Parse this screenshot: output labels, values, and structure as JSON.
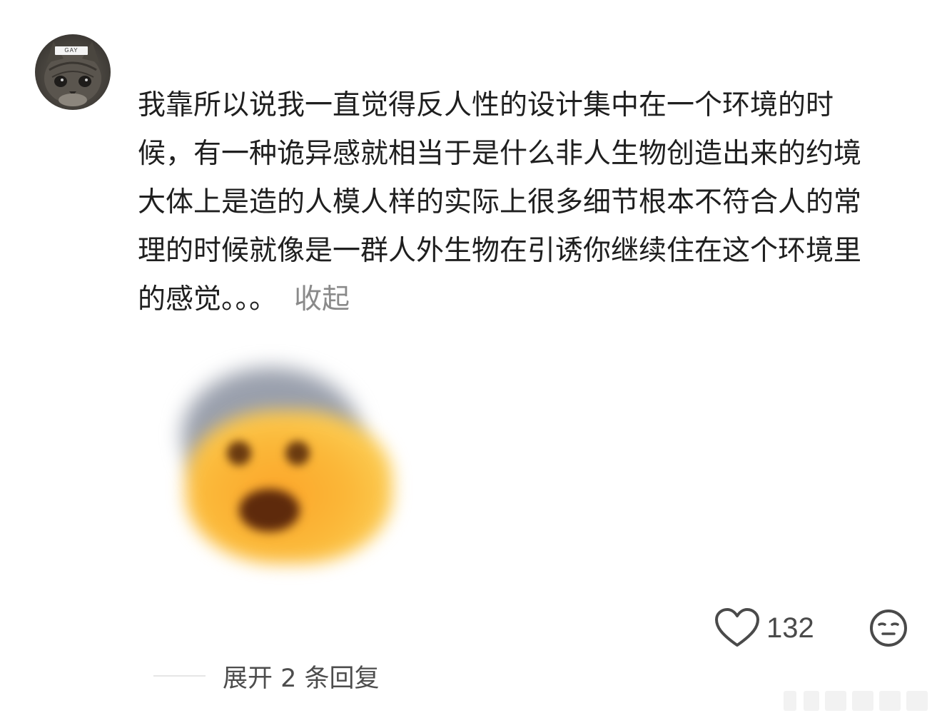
{
  "avatar": {
    "tag_text": "GAY",
    "icon": "cat-avatar-icon"
  },
  "comment": {
    "text": "我靠所以说我一直觉得反人性的设计集中在一个环境的时候，有一种诡异感就相当于是什么非人生物创造出来的约境大体上是造的人模人样的实际上很多细节根本不符合人的常理的时候就像是一群人外生物在引诱你继续住在这个环境里的感觉。。。",
    "collapse_label": "收起"
  },
  "sticker": {
    "icon": "shocked-emoji-sticker"
  },
  "actions": {
    "like_icon": "heart-outline-icon",
    "like_count": "132",
    "emoji_icon": "neutral-face-icon"
  },
  "replies": {
    "label": "展开 2 条回复"
  },
  "colors": {
    "text": "#1f1f1f",
    "muted": "#8a8a8a",
    "icon": "#4a4a4a",
    "background": "#ffffff"
  }
}
